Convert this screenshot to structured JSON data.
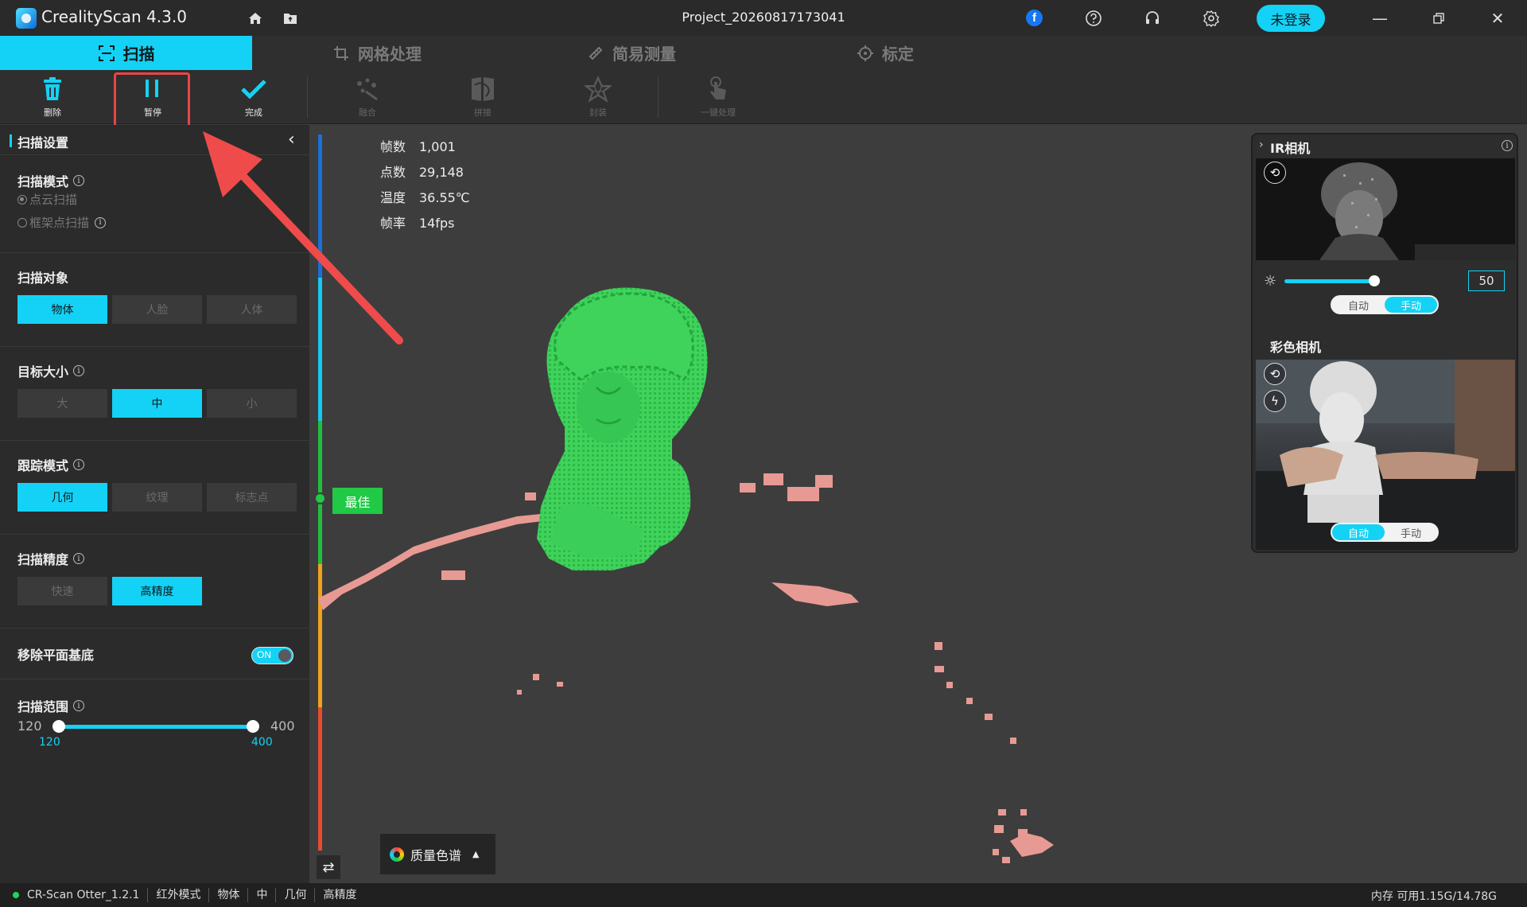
{
  "titlebar": {
    "app_title": "CrealityScan 4.3.0",
    "project_title": "Project_20260817173041",
    "login_label": "未登录"
  },
  "mode_tabs": [
    {
      "label": "扫描",
      "icon": "scan-frame-icon",
      "active": true
    },
    {
      "label": "网格处理",
      "icon": "crop-icon",
      "active": false
    },
    {
      "label": "简易测量",
      "icon": "ruler-icon",
      "active": false
    },
    {
      "label": "标定",
      "icon": "target-icon",
      "active": false
    }
  ],
  "toolbar": {
    "delete_label": "删除",
    "pause_label": "暂停",
    "done_label": "完成",
    "fuse_label": "融合",
    "stitch_label": "拼接",
    "encapsulate_label": "封装",
    "oneclick_label": "一键处理"
  },
  "left_panel": {
    "title": "扫描设置",
    "scan_mode": {
      "title": "扫描模式",
      "options": [
        "点云扫描",
        "框架点扫描"
      ],
      "selected": "点云扫描"
    },
    "scan_object": {
      "title": "扫描对象",
      "options": [
        "物体",
        "人脸",
        "人体"
      ],
      "selected": "物体"
    },
    "target_size": {
      "title": "目标大小",
      "options": [
        "大",
        "中",
        "小"
      ],
      "selected": "中"
    },
    "tracking_mode": {
      "title": "跟踪模式",
      "options": [
        "几何",
        "纹理",
        "标志点"
      ],
      "selected": "几何"
    },
    "scan_precision": {
      "title": "扫描精度",
      "options": [
        "快速",
        "高精度"
      ],
      "selected": "高精度"
    },
    "remove_plane": {
      "title": "移除平面基底",
      "toggle_label": "ON"
    },
    "scan_range": {
      "title": "扫描范围",
      "min": "120",
      "max": "400",
      "low": "120",
      "high": "400"
    }
  },
  "viewport": {
    "stats": [
      {
        "label": "帧数",
        "value": "1,001"
      },
      {
        "label": "点数",
        "value": "29,148"
      },
      {
        "label": "温度",
        "value": "36.55℃"
      },
      {
        "label": "帧率",
        "value": "14fps"
      }
    ],
    "best_label": "最佳",
    "colormap_label": "质量色谱"
  },
  "camera_panel": {
    "ir_title": "IR相机",
    "exposure_value": "50",
    "exposure_level": 0.75,
    "ir_modes": [
      "自动",
      "手动"
    ],
    "ir_selected": "手动",
    "color_title": "彩色相机",
    "color_modes": [
      "自动",
      "手动"
    ],
    "color_selected": "自动"
  },
  "statusbar": {
    "device": "CR-Scan Otter_1.2.1",
    "items": [
      "红外模式",
      "物体",
      "中",
      "几何",
      "高精度"
    ],
    "memory": "内存 可用1.15G/14.78G"
  },
  "colors": {
    "accent": "#14d2f5",
    "good": "#20c946",
    "highlight": "#e74545"
  }
}
